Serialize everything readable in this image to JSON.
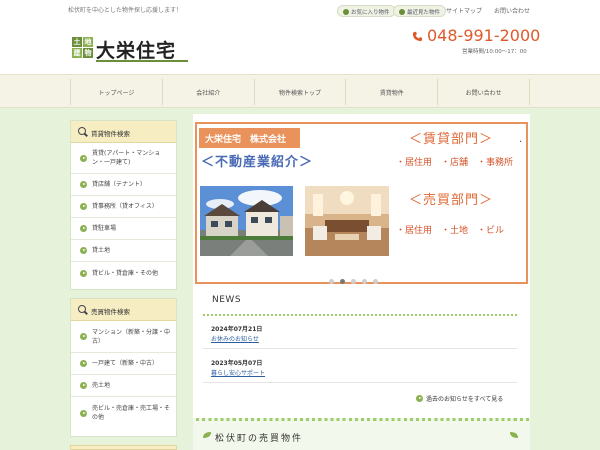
{
  "topbar": {
    "tagline": "松伏町を中心とした物件探し応援します！",
    "favorites": "お気に入り物件",
    "recent": "最近見た物件",
    "sitemap": "サイトマップ",
    "contact": "お問い合わせ"
  },
  "header": {
    "logo_blocks": [
      "土",
      "地",
      "建",
      "物"
    ],
    "brand": "大栄住宅",
    "phone": "048-991-2000",
    "hours": "営業時間/10:00～17：00"
  },
  "nav": {
    "items": [
      "トップページ",
      "会社紹介",
      "物件検索トップ",
      "賃貸物件",
      "お問い合わせ"
    ]
  },
  "sidebar": {
    "rental": {
      "title": "賃貸物件検索",
      "items": [
        "賃貸(アパート・マンション・一戸建て)",
        "貸店舗（テナント）",
        "貸事務所（貸オフィス）",
        "貸駐車場",
        "貸土地",
        "貸ビル・貸倉庫・その他"
      ]
    },
    "sale": {
      "title": "売買物件検索",
      "items": [
        "マンション（新築・分譲・中古）",
        "一戸建て（新築・中古）",
        "売土地",
        "売ビル・売倉庫・売工場・その他"
      ]
    }
  },
  "slider": {
    "company": "大栄住宅　株式会社",
    "intro": "＜不動産業紹介＞",
    "rent_title": "＜賃貸部門＞",
    "rent_dot": ".",
    "rent_items": "・居住用　・店舗　・事務所",
    "sale_title": "＜売買部門＞",
    "sale_items": "・居住用　・土地　・ビル",
    "dots_total": 5,
    "dots_active": 2
  },
  "news": {
    "title": "NEWS",
    "items": [
      {
        "date": "2024年07月21日",
        "text": "お休みのお知らせ"
      },
      {
        "date": "2023年05月07日",
        "text": "暮らし安心サポート"
      }
    ],
    "more": "過去のお知らせをすべて見る"
  },
  "section": {
    "title": "松伏町の売買物件"
  },
  "colors": {
    "accent_orange": "#e9925c",
    "accent_green": "#8ab04f",
    "phone": "#e0592a",
    "intro_blue": "#4b6bb5"
  }
}
